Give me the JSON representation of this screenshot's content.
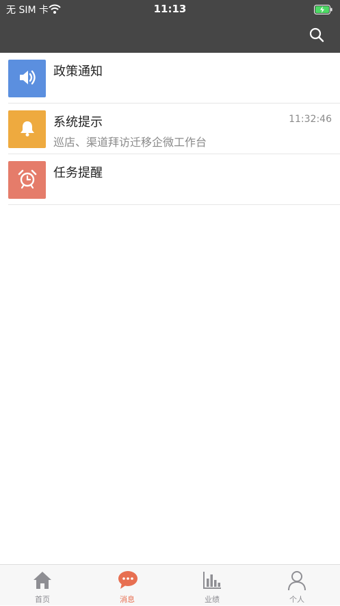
{
  "status_bar": {
    "carrier": "无 SIM 卡",
    "time": "11:13",
    "icons": [
      "wifi-icon",
      "battery-charging-icon"
    ]
  },
  "nav_bar": {
    "search_icon": "search-icon"
  },
  "messages": [
    {
      "title": "政策通知",
      "subtitle": "",
      "time": "",
      "icon": "speaker-icon",
      "color": "#5b8fdf"
    },
    {
      "title": "系统提示",
      "subtitle": "巡店、渠道拜访迁移企微工作台",
      "time": "11:32:46",
      "icon": "bell-icon",
      "color": "#eeaa3f"
    },
    {
      "title": "任务提醒",
      "subtitle": "",
      "time": "",
      "icon": "alarm-clock-icon",
      "color": "#e57c6a"
    }
  ],
  "tab_bar": {
    "items": [
      {
        "label": "首页",
        "icon": "home-icon",
        "active": false
      },
      {
        "label": "消息",
        "icon": "chat-bubble-icon",
        "active": true
      },
      {
        "label": "业绩",
        "icon": "bar-chart-icon",
        "active": false
      },
      {
        "label": "个人",
        "icon": "person-icon",
        "active": false
      }
    ],
    "active_color": "#e76f51",
    "inactive_color": "#8e8e93"
  }
}
